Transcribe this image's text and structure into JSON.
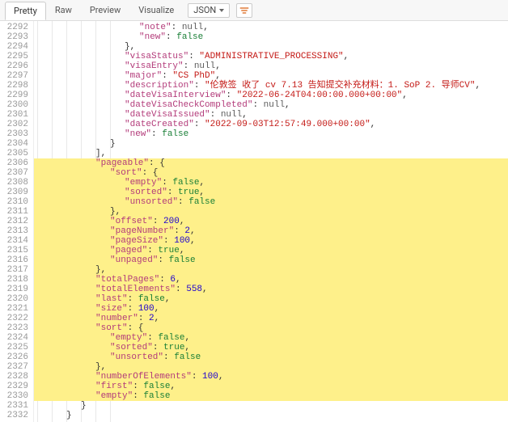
{
  "toolbar": {
    "tabs": [
      "Pretty",
      "Raw",
      "Preview",
      "Visualize"
    ],
    "activeTab": 0,
    "dropdownLabel": "JSON",
    "filterIcon": "filter-icon"
  },
  "lineStart": 2292,
  "highlightStart": 2306,
  "highlightEnd": 2330,
  "lines": [
    {
      "indent": 7,
      "tokens": [
        [
          "key",
          "\"note\""
        ],
        [
          "punc",
          ": "
        ],
        [
          "null",
          "null"
        ],
        [
          "punc",
          ","
        ]
      ]
    },
    {
      "indent": 7,
      "tokens": [
        [
          "key",
          "\"new\""
        ],
        [
          "punc",
          ": "
        ],
        [
          "bool-f",
          "false"
        ]
      ]
    },
    {
      "indent": 6,
      "tokens": [
        [
          "punc",
          "},"
        ]
      ]
    },
    {
      "indent": 6,
      "tokens": [
        [
          "key",
          "\"visaStatus\""
        ],
        [
          "punc",
          ": "
        ],
        [
          "str",
          "\"ADMINISTRATIVE_PROCESSING\""
        ],
        [
          "punc",
          ","
        ]
      ]
    },
    {
      "indent": 6,
      "tokens": [
        [
          "key",
          "\"visaEntry\""
        ],
        [
          "punc",
          ": "
        ],
        [
          "null",
          "null"
        ],
        [
          "punc",
          ","
        ]
      ]
    },
    {
      "indent": 6,
      "tokens": [
        [
          "key",
          "\"major\""
        ],
        [
          "punc",
          ": "
        ],
        [
          "str",
          "\"CS PhD\""
        ],
        [
          "punc",
          ","
        ]
      ]
    },
    {
      "indent": 6,
      "tokens": [
        [
          "key",
          "\"description\""
        ],
        [
          "punc",
          ": "
        ],
        [
          "str",
          "\"伦敦签 收了 cv 7.13 告知提交补充材料：1. SoP 2. 导师CV\""
        ],
        [
          "punc",
          ","
        ]
      ]
    },
    {
      "indent": 6,
      "tokens": [
        [
          "key",
          "\"dateVisaInterview\""
        ],
        [
          "punc",
          ": "
        ],
        [
          "str",
          "\"2022-06-24T04:00:00.000+00:00\""
        ],
        [
          "punc",
          ","
        ]
      ]
    },
    {
      "indent": 6,
      "tokens": [
        [
          "key",
          "\"dateVisaCheckCompleted\""
        ],
        [
          "punc",
          ": "
        ],
        [
          "null",
          "null"
        ],
        [
          "punc",
          ","
        ]
      ]
    },
    {
      "indent": 6,
      "tokens": [
        [
          "key",
          "\"dateVisaIssued\""
        ],
        [
          "punc",
          ": "
        ],
        [
          "null",
          "null"
        ],
        [
          "punc",
          ","
        ]
      ]
    },
    {
      "indent": 6,
      "tokens": [
        [
          "key",
          "\"dateCreated\""
        ],
        [
          "punc",
          ": "
        ],
        [
          "str",
          "\"2022-09-03T12:57:49.000+00:00\""
        ],
        [
          "punc",
          ","
        ]
      ]
    },
    {
      "indent": 6,
      "tokens": [
        [
          "key",
          "\"new\""
        ],
        [
          "punc",
          ": "
        ],
        [
          "bool-f",
          "false"
        ]
      ]
    },
    {
      "indent": 5,
      "tokens": [
        [
          "punc",
          "}"
        ]
      ]
    },
    {
      "indent": 4,
      "tokens": [
        [
          "punc",
          "],"
        ]
      ]
    },
    {
      "indent": 4,
      "tokens": [
        [
          "key",
          "\"pageable\""
        ],
        [
          "punc",
          ": {"
        ]
      ]
    },
    {
      "indent": 5,
      "tokens": [
        [
          "key",
          "\"sort\""
        ],
        [
          "punc",
          ": {"
        ]
      ]
    },
    {
      "indent": 6,
      "tokens": [
        [
          "key",
          "\"empty\""
        ],
        [
          "punc",
          ": "
        ],
        [
          "bool-f",
          "false"
        ],
        [
          "punc",
          ","
        ]
      ]
    },
    {
      "indent": 6,
      "tokens": [
        [
          "key",
          "\"sorted\""
        ],
        [
          "punc",
          ": "
        ],
        [
          "bool-t",
          "true"
        ],
        [
          "punc",
          ","
        ]
      ]
    },
    {
      "indent": 6,
      "tokens": [
        [
          "key",
          "\"unsorted\""
        ],
        [
          "punc",
          ": "
        ],
        [
          "bool-f",
          "false"
        ]
      ]
    },
    {
      "indent": 5,
      "tokens": [
        [
          "punc",
          "},"
        ]
      ]
    },
    {
      "indent": 5,
      "tokens": [
        [
          "key",
          "\"offset\""
        ],
        [
          "punc",
          ": "
        ],
        [
          "num",
          "200"
        ],
        [
          "punc",
          ","
        ]
      ]
    },
    {
      "indent": 5,
      "tokens": [
        [
          "key",
          "\"pageNumber\""
        ],
        [
          "punc",
          ": "
        ],
        [
          "num",
          "2"
        ],
        [
          "punc",
          ","
        ]
      ]
    },
    {
      "indent": 5,
      "tokens": [
        [
          "key",
          "\"pageSize\""
        ],
        [
          "punc",
          ": "
        ],
        [
          "num",
          "100"
        ],
        [
          "punc",
          ","
        ]
      ]
    },
    {
      "indent": 5,
      "tokens": [
        [
          "key",
          "\"paged\""
        ],
        [
          "punc",
          ": "
        ],
        [
          "bool-t",
          "true"
        ],
        [
          "punc",
          ","
        ]
      ]
    },
    {
      "indent": 5,
      "tokens": [
        [
          "key",
          "\"unpaged\""
        ],
        [
          "punc",
          ": "
        ],
        [
          "bool-f",
          "false"
        ]
      ]
    },
    {
      "indent": 4,
      "tokens": [
        [
          "punc",
          "},"
        ]
      ]
    },
    {
      "indent": 4,
      "tokens": [
        [
          "key",
          "\"totalPages\""
        ],
        [
          "punc",
          ": "
        ],
        [
          "num",
          "6"
        ],
        [
          "punc",
          ","
        ]
      ]
    },
    {
      "indent": 4,
      "tokens": [
        [
          "key",
          "\"totalElements\""
        ],
        [
          "punc",
          ": "
        ],
        [
          "num",
          "558"
        ],
        [
          "punc",
          ","
        ]
      ]
    },
    {
      "indent": 4,
      "tokens": [
        [
          "key",
          "\"last\""
        ],
        [
          "punc",
          ": "
        ],
        [
          "bool-f",
          "false"
        ],
        [
          "punc",
          ","
        ]
      ]
    },
    {
      "indent": 4,
      "tokens": [
        [
          "key",
          "\"size\""
        ],
        [
          "punc",
          ": "
        ],
        [
          "num",
          "100"
        ],
        [
          "punc",
          ","
        ]
      ]
    },
    {
      "indent": 4,
      "tokens": [
        [
          "key",
          "\"number\""
        ],
        [
          "punc",
          ": "
        ],
        [
          "num",
          "2"
        ],
        [
          "punc",
          ","
        ]
      ]
    },
    {
      "indent": 4,
      "tokens": [
        [
          "key",
          "\"sort\""
        ],
        [
          "punc",
          ": {"
        ]
      ]
    },
    {
      "indent": 5,
      "tokens": [
        [
          "key",
          "\"empty\""
        ],
        [
          "punc",
          ": "
        ],
        [
          "bool-f",
          "false"
        ],
        [
          "punc",
          ","
        ]
      ]
    },
    {
      "indent": 5,
      "tokens": [
        [
          "key",
          "\"sorted\""
        ],
        [
          "punc",
          ": "
        ],
        [
          "bool-t",
          "true"
        ],
        [
          "punc",
          ","
        ]
      ]
    },
    {
      "indent": 5,
      "tokens": [
        [
          "key",
          "\"unsorted\""
        ],
        [
          "punc",
          ": "
        ],
        [
          "bool-f",
          "false"
        ]
      ]
    },
    {
      "indent": 4,
      "tokens": [
        [
          "punc",
          "},"
        ]
      ]
    },
    {
      "indent": 4,
      "tokens": [
        [
          "key",
          "\"numberOfElements\""
        ],
        [
          "punc",
          ": "
        ],
        [
          "num",
          "100"
        ],
        [
          "punc",
          ","
        ]
      ]
    },
    {
      "indent": 4,
      "tokens": [
        [
          "key",
          "\"first\""
        ],
        [
          "punc",
          ": "
        ],
        [
          "bool-f",
          "false"
        ],
        [
          "punc",
          ","
        ]
      ]
    },
    {
      "indent": 4,
      "tokens": [
        [
          "key",
          "\"empty\""
        ],
        [
          "punc",
          ": "
        ],
        [
          "bool-f",
          "false"
        ]
      ]
    },
    {
      "indent": 3,
      "tokens": [
        [
          "punc",
          "}"
        ]
      ]
    },
    {
      "indent": 2,
      "tokens": [
        [
          "punc",
          "}"
        ]
      ]
    }
  ]
}
